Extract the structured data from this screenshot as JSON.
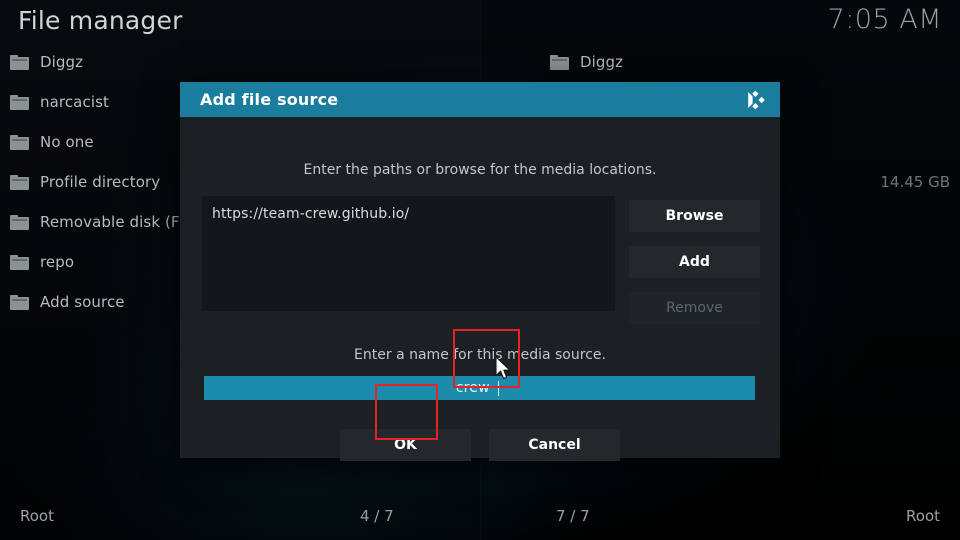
{
  "window": {
    "title": "File manager",
    "clock": "7:05 AM"
  },
  "left_panel": {
    "items": [
      {
        "label": "Diggz",
        "icon": "folder-icon",
        "size": ""
      },
      {
        "label": "narcacist",
        "icon": "folder-icon",
        "size": ""
      },
      {
        "label": "No one",
        "icon": "folder-icon",
        "size": ""
      },
      {
        "label": "Profile directory",
        "icon": "folder-icon",
        "size": ""
      },
      {
        "label": "Removable disk (F:)",
        "icon": "folder-icon",
        "size": ""
      },
      {
        "label": "repo",
        "icon": "folder-icon",
        "size": ""
      },
      {
        "label": "Add source",
        "icon": "folder-icon",
        "size": ""
      }
    ]
  },
  "right_panel": {
    "items": [
      {
        "label": "Diggz",
        "icon": "folder-icon",
        "size": ""
      },
      {
        "label": "",
        "icon": "",
        "size": ""
      },
      {
        "label": "",
        "icon": "",
        "size": ""
      },
      {
        "label": "",
        "icon": "",
        "size": "14.45 GB"
      }
    ]
  },
  "statusbar": {
    "left_path": "Root",
    "left_count": "4 / 7",
    "right_count": "7 / 7",
    "right_path": "Root"
  },
  "dialog": {
    "title": "Add file source",
    "logo_icon": "kodi-logo-icon",
    "hint_paths": "Enter the paths or browse for the media locations.",
    "paths": [
      "https://team-crew.github.io/"
    ],
    "side_buttons": [
      {
        "label": "Browse",
        "enabled": true
      },
      {
        "label": "Add",
        "enabled": true
      },
      {
        "label": "Remove",
        "enabled": false
      }
    ],
    "hint_name": "Enter a name for this media source.",
    "name_value": "crew",
    "name_placeholder": "Enter a name",
    "ok_label": "OK",
    "cancel_label": "Cancel"
  },
  "colors": {
    "accent_header": "#1b7d9e",
    "accent_field": "#1b8cab",
    "annotation": "#e8202a",
    "dialog_bg": "#1a2024",
    "input_bg": "#12181a",
    "button_bg": "#22282c"
  }
}
